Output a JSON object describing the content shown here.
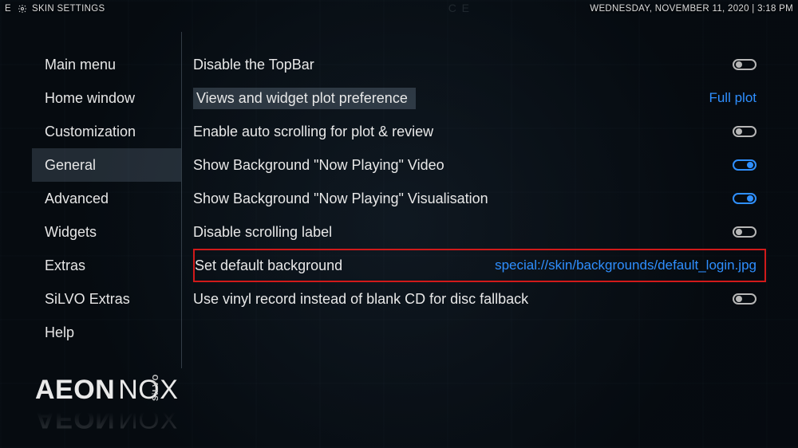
{
  "topbar": {
    "title": "SKIN SETTINGS",
    "datetime": "WEDNESDAY, NOVEMBER 11, 2020 | 3:18 PM"
  },
  "sidebar": {
    "items": [
      {
        "label": "Main menu"
      },
      {
        "label": "Home window"
      },
      {
        "label": "Customization"
      },
      {
        "label": "General"
      },
      {
        "label": "Advanced"
      },
      {
        "label": "Widgets"
      },
      {
        "label": "Extras"
      },
      {
        "label": "SiLVO Extras"
      },
      {
        "label": "Help"
      }
    ],
    "selected_index": 3
  },
  "settings": {
    "rows": [
      {
        "label": "Disable the TopBar",
        "type": "toggle",
        "state": "off"
      },
      {
        "label": "Views and widget plot preference",
        "type": "value",
        "value": "Full plot",
        "highlight_label": true
      },
      {
        "label": "Enable auto scrolling for plot & review",
        "type": "toggle",
        "state": "off"
      },
      {
        "label": "Show Background \"Now Playing\" Video",
        "type": "toggle",
        "state": "on"
      },
      {
        "label": "Show Background \"Now Playing\" Visualisation",
        "type": "toggle",
        "state": "on"
      },
      {
        "label": "Disable scrolling label",
        "type": "toggle",
        "state": "off"
      },
      {
        "label": "Set default background",
        "type": "value",
        "value": "special://skin/backgrounds/default_login.jpg",
        "boxed": true
      },
      {
        "label": "Use vinyl record instead of blank CD for disc fallback",
        "type": "toggle",
        "state": "off"
      }
    ]
  },
  "brand": {
    "line1a": "AEON",
    "line1b": "NOX",
    "sub": "SiLVO"
  }
}
